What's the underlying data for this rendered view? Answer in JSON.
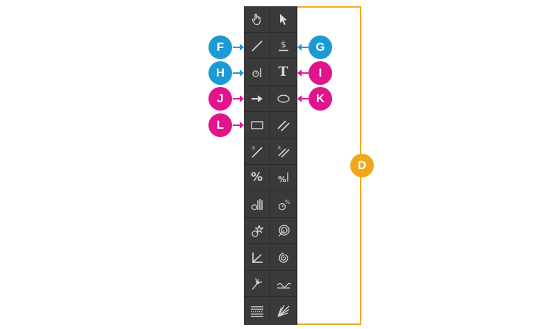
{
  "colors": {
    "toolbar_bg": "#3a3a3a",
    "icon": "#d6d6d6",
    "callout_blue": "#1b9ad6",
    "callout_pink": "#e0148c",
    "callout_orange": "#f0a81a"
  },
  "toolbar": {
    "rows": [
      [
        "hand-tool-icon",
        "pointer-tool-icon"
      ],
      [
        "line-tool-icon",
        "dollar-value-tool-icon"
      ],
      [
        "timer-marker-tool-icon",
        "text-tool-icon"
      ],
      [
        "arrow-tool-icon",
        "ellipse-tool-icon"
      ],
      [
        "rectangle-tool-icon",
        "parallel-lines-tool-icon"
      ],
      [
        "ray-line-tool-icon",
        "ray-parallel-tool-icon"
      ],
      [
        "percent-tool-icon",
        "percent-line-tool-icon"
      ],
      [
        "timer-bars-tool-icon",
        "timer-percent-tool-icon"
      ],
      [
        "timer-star-tool-icon",
        "spiral-target-tool-icon"
      ],
      [
        "angle-tool-icon",
        "fibonacci-spiral-tool-icon"
      ],
      [
        "pitchfork-tool-icon",
        "wave-tool-icon"
      ],
      [
        "horizontal-lines-tool-icon",
        "fan-lines-tool-icon"
      ]
    ],
    "text_glyphs": {
      "dollar": "$",
      "text_tool": "T",
      "percent": "%",
      "ray_r": "R"
    }
  },
  "callouts": {
    "F": "F",
    "G": "G",
    "H": "H",
    "I": "I",
    "J": "J",
    "K": "K",
    "L": "L",
    "D": "D"
  }
}
